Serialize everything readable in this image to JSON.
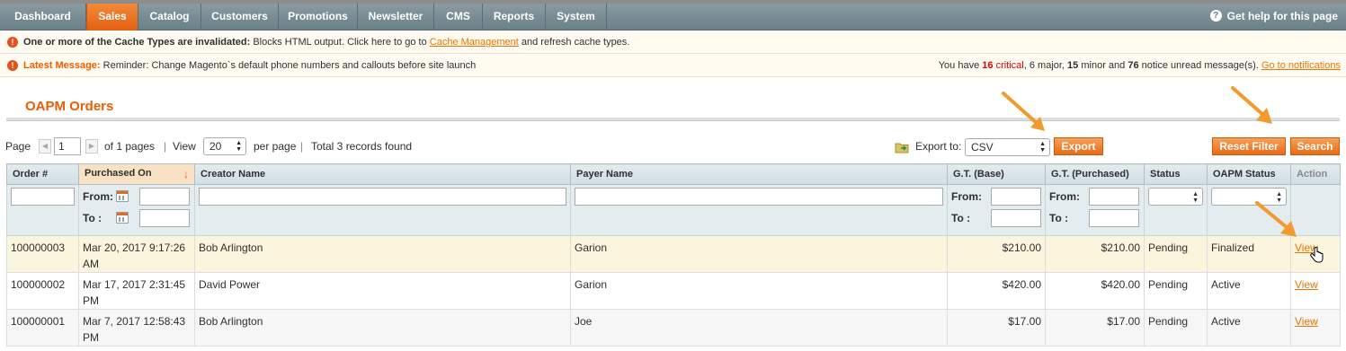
{
  "nav": {
    "items": [
      "Dashboard",
      "Sales",
      "Catalog",
      "Customers",
      "Promotions",
      "Newsletter",
      "CMS",
      "Reports",
      "System"
    ],
    "active": "Sales",
    "help": "Get help for this page"
  },
  "notices": {
    "cache": {
      "bold": "One or more of the Cache Types are invalidated:",
      "text": " Blocks HTML output. Click here to go to ",
      "link": "Cache Management",
      "tail": " and refresh cache types."
    },
    "latest": {
      "label": "Latest Message:",
      "text": " Reminder: Change Magento`s default phone numbers and callouts before site launch",
      "you_have": "You have ",
      "critical_count": "16",
      "critical_word": " critical",
      "major": ", 6 major, ",
      "minor_count": "15",
      "minor": " minor and ",
      "notice_count": "76",
      "notice": " notice unread message(s). ",
      "link": "Go to notifications"
    }
  },
  "page_title": "OAPM Orders",
  "pager": {
    "page_label": "Page",
    "page_value": "1",
    "of_pages": "of 1 pages",
    "view_label": "View",
    "per_page_value": "20",
    "per_page_label": "per page",
    "total": "Total 3 records found",
    "separator": "|"
  },
  "export": {
    "label": "Export to:",
    "format": "CSV",
    "button": "Export"
  },
  "buttons": {
    "reset_filter": "Reset Filter",
    "search": "Search"
  },
  "grid": {
    "columns": [
      "Order #",
      "Purchased On",
      "Creator Name",
      "Payer Name",
      "G.T. (Base)",
      "G.T. (Purchased)",
      "Status",
      "OAPM Status",
      "Action"
    ],
    "sorted_column": "Purchased On",
    "sort_arrow": "↓",
    "filter_from": "From:",
    "filter_to": "To :",
    "rows": [
      {
        "order": "100000003",
        "date1": "Mar 20, 2017 9:17:26",
        "date2": "AM",
        "creator": "Bob Arlington",
        "payer": "Garion",
        "gt_base": "$210.00",
        "gt_purchased": "$210.00",
        "status": "Pending",
        "oapm_status": "Finalized",
        "action": "View"
      },
      {
        "order": "100000002",
        "date1": "Mar 17, 2017 2:31:45",
        "date2": "PM",
        "creator": "David Power",
        "payer": "Garion",
        "gt_base": "$420.00",
        "gt_purchased": "$420.00",
        "status": "Pending",
        "oapm_status": "Active",
        "action": "View"
      },
      {
        "order": "100000001",
        "date1": "Mar 7, 2017 12:58:43",
        "date2": "PM",
        "creator": "Bob Arlington",
        "payer": "Joe",
        "gt_base": "$17.00",
        "gt_purchased": "$17.00",
        "status": "Pending",
        "oapm_status": "Active",
        "action": "View"
      }
    ]
  },
  "colors": {
    "accent": "#eb5e00",
    "nav": "#6f8992",
    "button": "#f18022",
    "highlight_row": "#fcf5dd"
  }
}
